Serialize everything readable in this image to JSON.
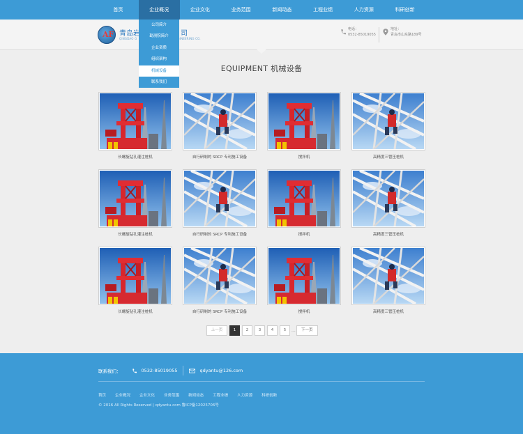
{
  "nav": {
    "items": [
      {
        "label": "首页"
      },
      {
        "label": "企业概况"
      },
      {
        "label": "企业文化"
      },
      {
        "label": "业务范围"
      },
      {
        "label": "新闻动态"
      },
      {
        "label": "工程业绩"
      },
      {
        "label": "人力资源"
      },
      {
        "label": "科研创新"
      }
    ],
    "active_index": 1
  },
  "dropdown": {
    "items": [
      {
        "label": "公司简介"
      },
      {
        "label": "勘测院简介"
      },
      {
        "label": "企业资质"
      },
      {
        "label": "组织架构"
      },
      {
        "label": "机械设备"
      },
      {
        "label": "联系我们"
      }
    ],
    "active_index": 4
  },
  "header": {
    "logo_letters": "AF",
    "company_name_visible_left": "青岛岩",
    "company_name_visible_right": "司",
    "company_sub_visible_left": "QINGDAO G",
    "company_sub_visible_right": "Y ENGINEERING CO.",
    "phone_label": "电话：",
    "phone": "0532-85019055",
    "address_label": "地址：",
    "address": "青岛市山东路189号"
  },
  "section": {
    "title": "EQUIPMENT  机械设备"
  },
  "equipment": [
    {
      "caption": "长螺旋钻孔灌注桩机",
      "image": "red-rig"
    },
    {
      "caption": "自行研制的 SRCP 专利施工设备",
      "image": "white-frame"
    },
    {
      "caption": "搅拌机",
      "image": "red-rig"
    },
    {
      "caption": "高精度三管压桩机",
      "image": "white-frame"
    },
    {
      "caption": "长螺旋钻孔灌注桩机",
      "image": "red-rig"
    },
    {
      "caption": "自行研制的 SRCP 专利施工设备",
      "image": "white-frame"
    },
    {
      "caption": "搅拌机",
      "image": "red-rig"
    },
    {
      "caption": "高精度三管压桩机",
      "image": "white-frame"
    },
    {
      "caption": "长螺旋钻孔灌注桩机",
      "image": "red-rig"
    },
    {
      "caption": "自行研制的 SRCP 专利施工设备",
      "image": "white-frame"
    },
    {
      "caption": "搅拌机",
      "image": "red-rig"
    },
    {
      "caption": "高精度三管压桩机",
      "image": "white-frame"
    }
  ],
  "pagination": {
    "prev": "上一页",
    "pages": [
      "1",
      "2",
      "3",
      "4",
      "5"
    ],
    "current": "1",
    "ellipsis": "...",
    "next": "下一页"
  },
  "footer": {
    "contact_label": "联系我们：",
    "phone": "0532-85019055",
    "email": "qdyantu@126.com",
    "links": [
      "首页",
      "企业概况",
      "企业文化",
      "业务范围",
      "新闻动态",
      "工程业绩",
      "人力资源",
      "科研创新"
    ],
    "copyright": "© 2016 All Rights Reserved   |   qdyantu.com       鲁ICP备12025706号"
  },
  "colors": {
    "primary": "#3d9bd6",
    "nav_active": "#2a6fa3",
    "pagination_current": "#333333"
  }
}
